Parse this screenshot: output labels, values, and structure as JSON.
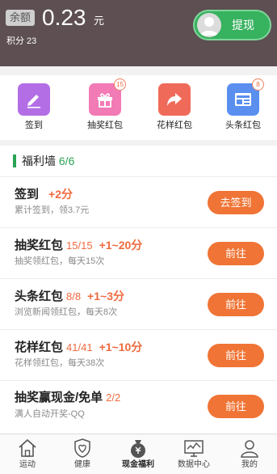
{
  "header": {
    "balance_tag": "余额",
    "balance_value": "0.23",
    "balance_unit": "元",
    "points": "积分 23",
    "withdraw_label": "提现"
  },
  "quick_actions": [
    {
      "label": "签到",
      "icon": "pencil-icon",
      "color": "#b36ee6",
      "badge": ""
    },
    {
      "label": "抽奖红包",
      "icon": "gift-icon",
      "color": "#f27ab5",
      "badge": "15"
    },
    {
      "label": "花样红包",
      "icon": "share-arrow-icon",
      "color": "#f06a5a",
      "badge": ""
    },
    {
      "label": "头条红包",
      "icon": "news-icon",
      "color": "#5a8ff0",
      "badge": "8"
    }
  ],
  "wall": {
    "title": "福利墙",
    "count": "6/6",
    "accent": "#2aa354"
  },
  "tasks": [
    {
      "title": "签到",
      "progress": "",
      "reward": "+2分",
      "desc": "累计签到，领3.7元",
      "button": "去签到"
    },
    {
      "title": "抽奖红包",
      "progress": "15/15",
      "reward": "+1~20分",
      "desc": "抽奖领红包，每天15次",
      "button": "前往"
    },
    {
      "title": "头条红包",
      "progress": "8/8",
      "reward": "+1~3分",
      "desc": "浏览新闻领红包，每天8次",
      "button": "前往"
    },
    {
      "title": "花样红包",
      "progress": "41/41",
      "reward": "+1~10分",
      "desc": "花样领红包，每天38次",
      "button": "前往"
    },
    {
      "title": "抽奖赢现金/免单",
      "progress": "2/2",
      "reward": "",
      "desc": "满人自动开奖-QQ",
      "button": "前往"
    }
  ],
  "nav": [
    {
      "label": "运动",
      "icon": "home-icon"
    },
    {
      "label": "健康",
      "icon": "heart-shield-icon"
    },
    {
      "label": "现金福利",
      "icon": "money-bag-icon",
      "active": true
    },
    {
      "label": "数据中心",
      "icon": "chart-monitor-icon"
    },
    {
      "label": "我的",
      "icon": "user-icon"
    }
  ],
  "colors": {
    "header_bg": "#5d4f52",
    "withdraw_bg": "#37b25f",
    "orange": "#f07435",
    "reward": "#f06a3f"
  }
}
